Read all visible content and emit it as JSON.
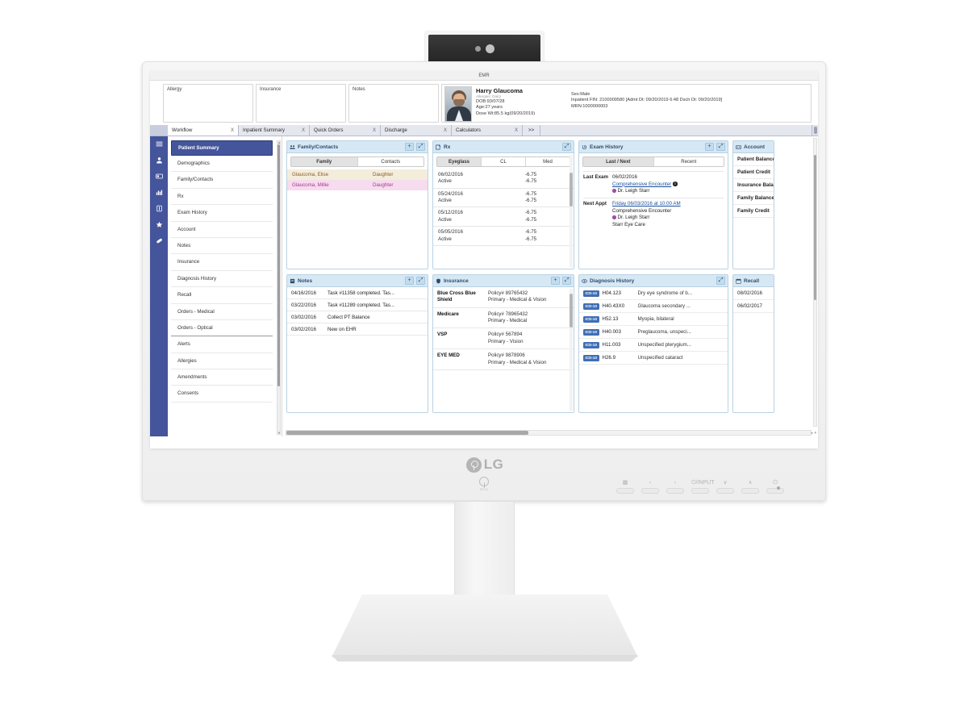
{
  "monitor": {
    "brand": "LG",
    "rfid_label": "RFID",
    "osd_buttons": [
      {
        "name": "menu-grid-button",
        "glyph": "▦"
      },
      {
        "name": "left-button",
        "glyph": "‹"
      },
      {
        "name": "right-button",
        "glyph": "›"
      },
      {
        "name": "input-button",
        "glyph": "⏻/INPUT"
      },
      {
        "name": "down-button",
        "glyph": "∨"
      },
      {
        "name": "up-button",
        "glyph": "∧"
      },
      {
        "name": "power-button",
        "glyph": "⏻"
      }
    ]
  },
  "app": {
    "title": "EMR",
    "header_cards": [
      {
        "label": "Allergy"
      },
      {
        "label": "Insurance"
      },
      {
        "label": "Notes"
      }
    ],
    "patient": {
      "name": "Harry Glaucoma",
      "allergies": "Allergies: Dairy",
      "dob": "DOB:93/07/28",
      "age": "Age:27 years",
      "dose_wt": "Dose Wt:85.5 kg(09/20/2019)",
      "sex": "Sex:Male",
      "encounter": "Inpatient FIN: 2100009580 [Admt Dt: 09/20/2019 6:48 Dsch Dt: 09/20/2019]",
      "mrn": "MRN:1000000003"
    },
    "tabs": [
      {
        "label": "Workflow",
        "close": "X",
        "active": true
      },
      {
        "label": "Inpatient Summary",
        "close": "X",
        "active": false
      },
      {
        "label": "Quick Orders",
        "close": "X",
        "active": false
      },
      {
        "label": "Discharge",
        "close": "X",
        "active": false
      },
      {
        "label": "Calculators",
        "close": "X",
        "active": false
      },
      {
        "label": ">>",
        "close": "",
        "active": false
      }
    ],
    "rail_icons": [
      {
        "name": "menu-icon",
        "glyph": "hamburger"
      },
      {
        "name": "person-icon",
        "glyph": "person"
      },
      {
        "name": "card-icon",
        "glyph": "card"
      },
      {
        "name": "chart-icon",
        "glyph": "chart"
      },
      {
        "name": "book-icon",
        "glyph": "book"
      },
      {
        "name": "star-icon",
        "glyph": "star"
      },
      {
        "name": "pill-icon",
        "glyph": "pill"
      }
    ],
    "nav_items": [
      {
        "label": "Patient Summary",
        "active": true
      },
      {
        "label": "Demographics",
        "active": false
      },
      {
        "label": "Family/Contacts",
        "active": false
      },
      {
        "label": "Rx",
        "active": false
      },
      {
        "label": "Exam History",
        "active": false
      },
      {
        "label": "Account",
        "active": false
      },
      {
        "label": "Notes",
        "active": false
      },
      {
        "label": "Insurance",
        "active": false
      },
      {
        "label": "Diagnosis History",
        "active": false
      },
      {
        "label": "Recall",
        "active": false
      },
      {
        "label": "Orders - Medical",
        "active": false
      },
      {
        "label": "Orders - Optical",
        "active": false
      },
      {
        "label": "Alerts",
        "active": false
      },
      {
        "label": "Allergies",
        "active": false
      },
      {
        "label": "Amendments",
        "active": false
      },
      {
        "label": "Consents",
        "active": false
      }
    ]
  },
  "panels": {
    "family_contacts": {
      "title": "Family/Contacts",
      "add_label": "+",
      "expand_label": "⤢",
      "tabs": [
        {
          "label": "Family",
          "active": true
        },
        {
          "label": "Contacts",
          "active": false
        }
      ],
      "rows": [
        {
          "name": "Glaucoma, Elise",
          "relation": "Daughter",
          "tone": "beige"
        },
        {
          "name": "Glaucoma, Millie",
          "relation": "Daughter",
          "tone": "pink"
        }
      ]
    },
    "rx": {
      "title": "Rx",
      "expand_label": "⤢",
      "tabs": [
        {
          "label": "Eyeglass",
          "active": true
        },
        {
          "label": "CL",
          "active": false
        },
        {
          "label": "Med",
          "active": false
        }
      ],
      "rows": [
        {
          "date": "06/02/2016",
          "status": "Active",
          "od": "-6.75",
          "os": "-6.75"
        },
        {
          "date": "05/24/2016",
          "status": "Active",
          "od": "-6.75",
          "os": "-6.75"
        },
        {
          "date": "05/12/2016",
          "status": "Active",
          "od": "-6.75",
          "os": "-6.75"
        },
        {
          "date": "05/05/2016",
          "status": "Active",
          "od": "-6.75",
          "os": "-6.75"
        }
      ]
    },
    "exam_history": {
      "title": "Exam History",
      "add_label": "+",
      "expand_label": "⤢",
      "tabs": [
        {
          "label": "Last / Next",
          "active": true
        },
        {
          "label": "Recent",
          "active": false
        }
      ],
      "last_exam_label": "Last Exam",
      "last_exam_date": "06/02/2016",
      "last_exam_type": "Comprehensive Encounter",
      "last_exam_provider": "Dr. Leigh Starr",
      "next_appt_label": "Next Appt",
      "next_appt_date": "Friday 06/03/2016 at 10:00 AM",
      "next_appt_type": "Comprehensive Encounter",
      "next_appt_provider": "Dr. Leigh Starr",
      "next_appt_location": "Starr Eye Care"
    },
    "account": {
      "title": "Account",
      "items": [
        {
          "label": "Patient Balance"
        },
        {
          "label": "Patient Credit"
        },
        {
          "label": "Insurance Balance"
        },
        {
          "label": "Family Balance"
        },
        {
          "label": "Family Credit"
        }
      ]
    },
    "notes": {
      "title": "Notes",
      "add_label": "+",
      "expand_label": "⤢",
      "rows": [
        {
          "date": "04/16/2016",
          "text": "Task #11358 completed. Tas..."
        },
        {
          "date": "03/22/2016",
          "text": "Task #11289 completed. Tas..."
        },
        {
          "date": "03/02/2016",
          "text": "Collect PT Balance"
        },
        {
          "date": "03/02/2016",
          "text": "New on EHR"
        }
      ]
    },
    "insurance": {
      "title": "Insurance",
      "add_label": "+",
      "expand_label": "⤢",
      "rows": [
        {
          "name": "Blue Cross Blue Shield",
          "policy": "Policy# 89765432",
          "type": "Primary - Medical & Vision"
        },
        {
          "name": "Medicare",
          "policy": "Policy# 78965432",
          "type": "Primary - Medical"
        },
        {
          "name": "VSP",
          "policy": "Policy# 567894",
          "type": "Primary - Vision"
        },
        {
          "name": "EYE MED",
          "policy": "Policy# 9878906",
          "type": "Primary - Medical & Vision"
        }
      ]
    },
    "diagnosis_history": {
      "title": "Diagnosis History",
      "expand_label": "⤢",
      "tag": "ICD-10",
      "rows": [
        {
          "code": "H04.123",
          "desc": "Dry eye syndrome of b..."
        },
        {
          "code": "H40.43X0",
          "desc": "Glaucoma secondary ..."
        },
        {
          "code": "H52.13",
          "desc": "Myopia, bilateral"
        },
        {
          "code": "H40.003",
          "desc": "Preglaucoma, unspeci..."
        },
        {
          "code": "H11.003",
          "desc": "Unspecified pterygium..."
        },
        {
          "code": "H26.9",
          "desc": "Unspecified cataract"
        }
      ]
    },
    "recall": {
      "title": "Recall",
      "rows": [
        {
          "date": "08/02/2016"
        },
        {
          "date": "06/02/2017"
        }
      ]
    }
  }
}
